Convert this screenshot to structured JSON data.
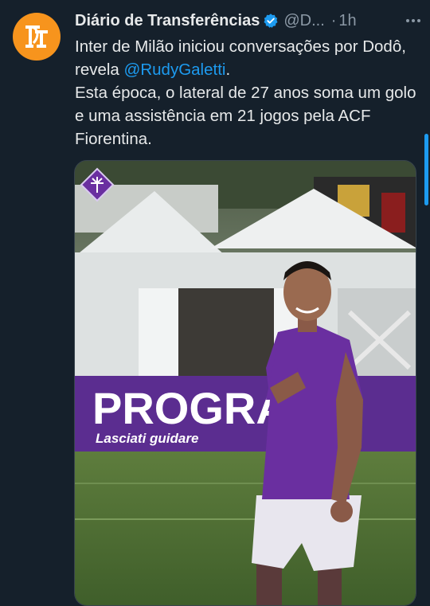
{
  "tweet": {
    "author_name": "Diário de Transferências",
    "handle": "@D...",
    "separator": "·",
    "time": "1h",
    "text_line1_prefix": "Inter de Milão iniciou conversações por Dodô, revela ",
    "mention": "@RudyGaletti",
    "text_line1_suffix": ".",
    "text_line2": "Esta época, o lateral de 27 anos soma um golo e uma assistência em 21 jogos pela ACF Fiorentina."
  },
  "media": {
    "sponsor_banner_text": "PROGRA",
    "sponsor_banner_subtext": "Lasciati guidare"
  },
  "icons": {
    "avatar": "dt-logo-icon",
    "verified": "verified-badge-icon",
    "more": "more-options-icon",
    "club_crest": "fiorentina-crest-icon"
  },
  "colors": {
    "background": "#15202b",
    "accent": "#1d9bf0",
    "avatar_orange": "#f7941d",
    "jersey_purple": "#6a2fa0"
  }
}
